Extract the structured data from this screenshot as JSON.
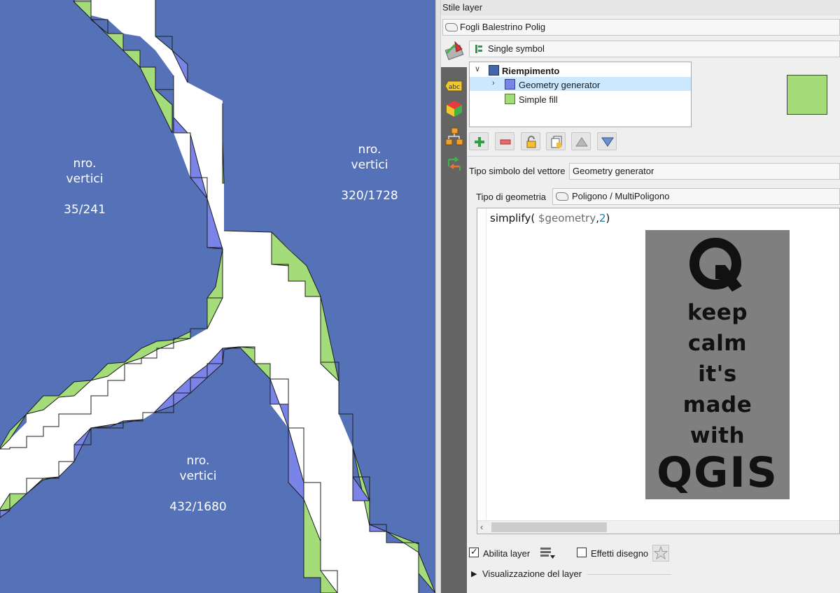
{
  "map": {
    "labels": [
      {
        "line1": "nro.",
        "line2": "vertici",
        "count": "35/241"
      },
      {
        "line1": "nro.",
        "line2": "vertici",
        "count": "320/1728"
      },
      {
        "line1": "nro.",
        "line2": "vertici",
        "count": "432/1680"
      }
    ],
    "colors": {
      "polygon": "#5572b8",
      "simplified_fill": "#a5dc7a",
      "generator_fill": "#7a84e8",
      "gap": "#ffffff"
    }
  },
  "panel": {
    "title": "Stile layer",
    "layer_name": "Fogli Balestrino Polig",
    "renderer": "Single symbol",
    "tree": {
      "root": "Riempimento",
      "child1": "Geometry generator",
      "child2": "Simple fill"
    },
    "symbol_type_label": "Tipo simbolo del vettore",
    "symbol_type_value": "Geometry generator",
    "geometry_type_label": "Tipo di geometria",
    "geometry_type_value": "Poligono / MultiPoligono",
    "expression": {
      "func": "simplify( ",
      "var": "$geometry",
      "sep": ",",
      "num": "2",
      "close": ")"
    },
    "logo": {
      "text": [
        "keep",
        "calm",
        "it's",
        "made",
        "with"
      ],
      "brand": "QGIS"
    },
    "enable_layer": "Abilita layer",
    "draw_effects": "Effetti disegno",
    "visualization": "Visualizzazione del layer"
  }
}
